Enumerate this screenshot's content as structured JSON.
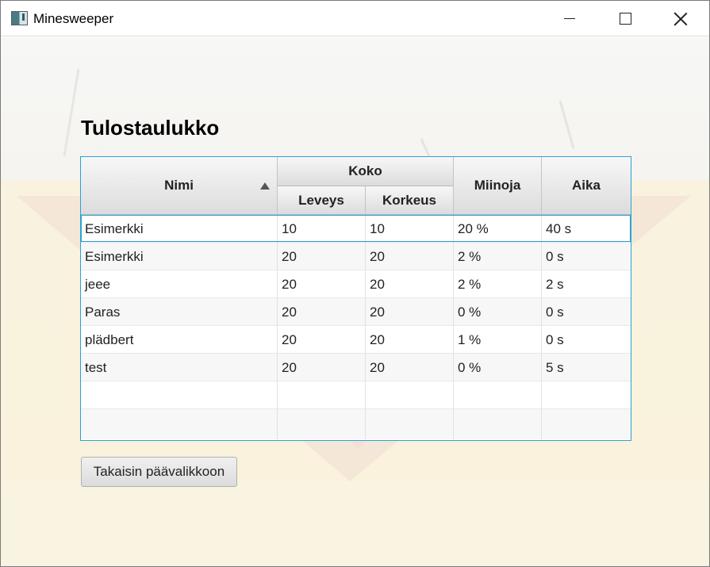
{
  "window": {
    "title": "Minesweeper",
    "controls": [
      "minimize",
      "maximize",
      "close"
    ]
  },
  "heading": "Tulostaulukko",
  "table": {
    "columns": {
      "name": "Nimi",
      "size_group": "Koko",
      "width": "Leveys",
      "height": "Korkeus",
      "mines": "Miinoja",
      "time": "Aika"
    },
    "sort": {
      "column": "Nimi",
      "direction": "ascending"
    },
    "selected_row": 0,
    "rows": [
      [
        "Esimerkki",
        "10",
        "10",
        "20 %",
        "40 s"
      ],
      [
        "Esimerkki",
        "20",
        "20",
        "2 %",
        "0 s"
      ],
      [
        "jeee",
        "20",
        "20",
        "2 %",
        "2 s"
      ],
      [
        "Paras",
        "20",
        "20",
        "0 %",
        "0 s"
      ],
      [
        "plädbert",
        "20",
        "20",
        "1 %",
        "0 s"
      ],
      [
        "test",
        "20",
        "20",
        "0 %",
        "5 s"
      ],
      [
        "",
        "",
        "",
        "",
        ""
      ],
      [
        "",
        "",
        "",
        "",
        ""
      ]
    ]
  },
  "back_button": "Takaisin päävalikkoon",
  "colors": {
    "focus_border": "#2aa3cf",
    "header_top": "#f7f7f7",
    "header_bottom": "#dcdcdc"
  }
}
